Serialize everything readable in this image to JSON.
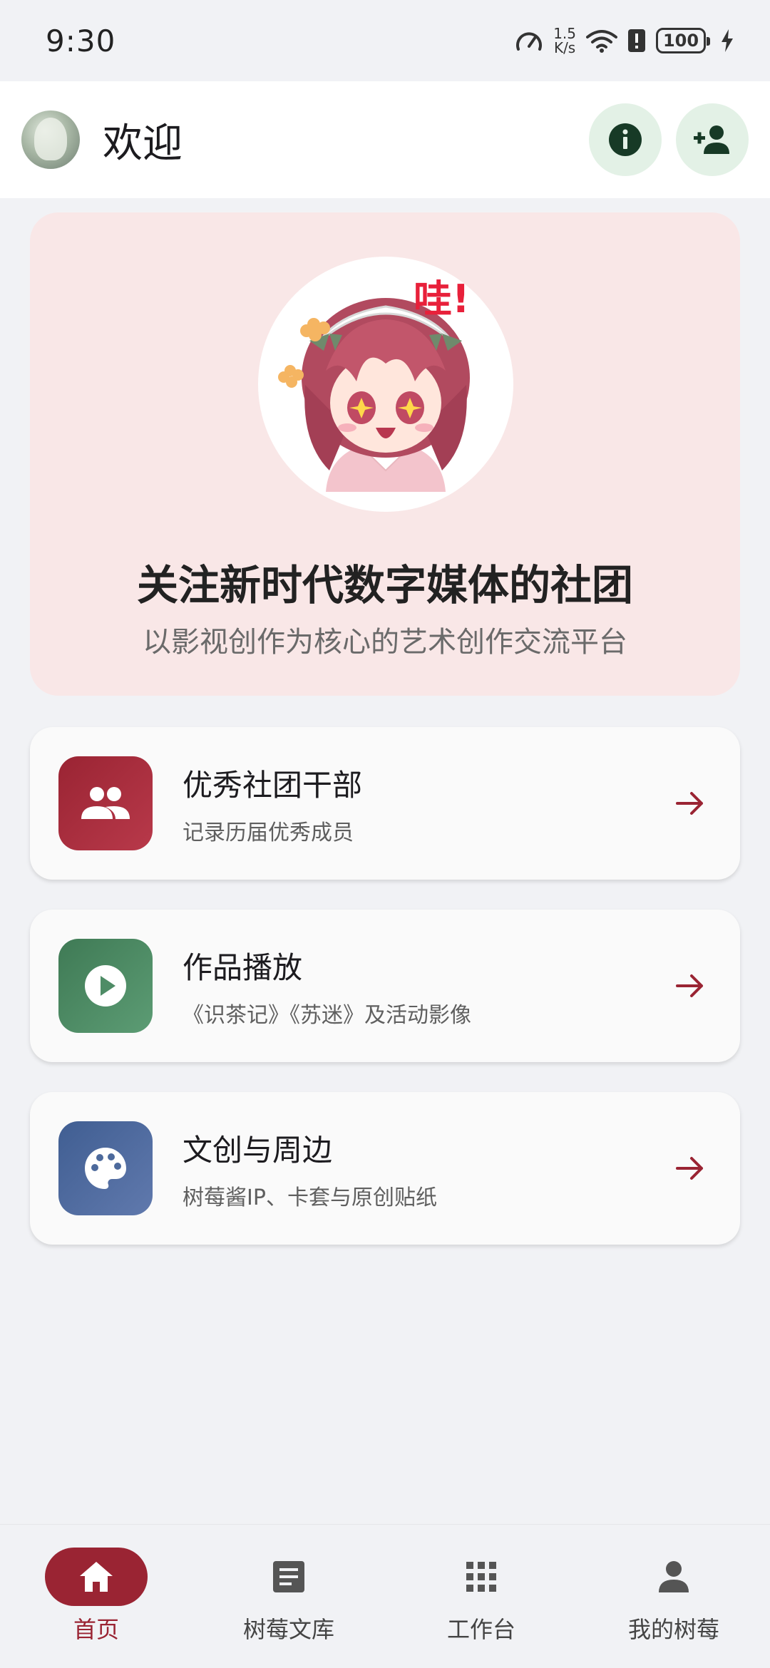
{
  "status_bar": {
    "time": "9:30",
    "net_speed_value": "1.5",
    "net_speed_unit": "K/s",
    "battery": "100",
    "icons": [
      "speedometer-icon",
      "wifi-icon",
      "alert-icon",
      "battery-icon",
      "charging-icon"
    ]
  },
  "app_bar": {
    "title": "欢迎",
    "actions": [
      {
        "icon": "info-icon"
      },
      {
        "icon": "person-add-icon"
      }
    ]
  },
  "hero": {
    "title": "关注新时代数字媒体的社团",
    "subtitle": "以影视创作为核心的艺术创作交流平台",
    "mascot_text": "哇!"
  },
  "cards": [
    {
      "title": "优秀社团干部",
      "desc": "记录历届优秀成员",
      "icon": "group-icon",
      "color": "#a82c3c"
    },
    {
      "title": "作品播放",
      "desc": "《识茶记》《苏迷》及活动影像",
      "icon": "play-circle-icon",
      "color": "#4e8c66"
    },
    {
      "title": "文创与周边",
      "desc": "树莓酱IP、卡套与原创贴纸",
      "icon": "palette-icon",
      "color": "#4d6a9c"
    }
  ],
  "bottom_nav": [
    {
      "label": "首页",
      "icon": "home-icon",
      "active": true
    },
    {
      "label": "树莓文库",
      "icon": "article-icon",
      "active": false
    },
    {
      "label": "工作台",
      "icon": "apps-grid-icon",
      "active": false
    },
    {
      "label": "我的树莓",
      "icon": "person-icon",
      "active": false
    }
  ],
  "colors": {
    "accent": "#9a2433",
    "hero_bg": "#f9e7e7",
    "action_bg": "#e3f1e6",
    "action_icon": "#173a26"
  }
}
